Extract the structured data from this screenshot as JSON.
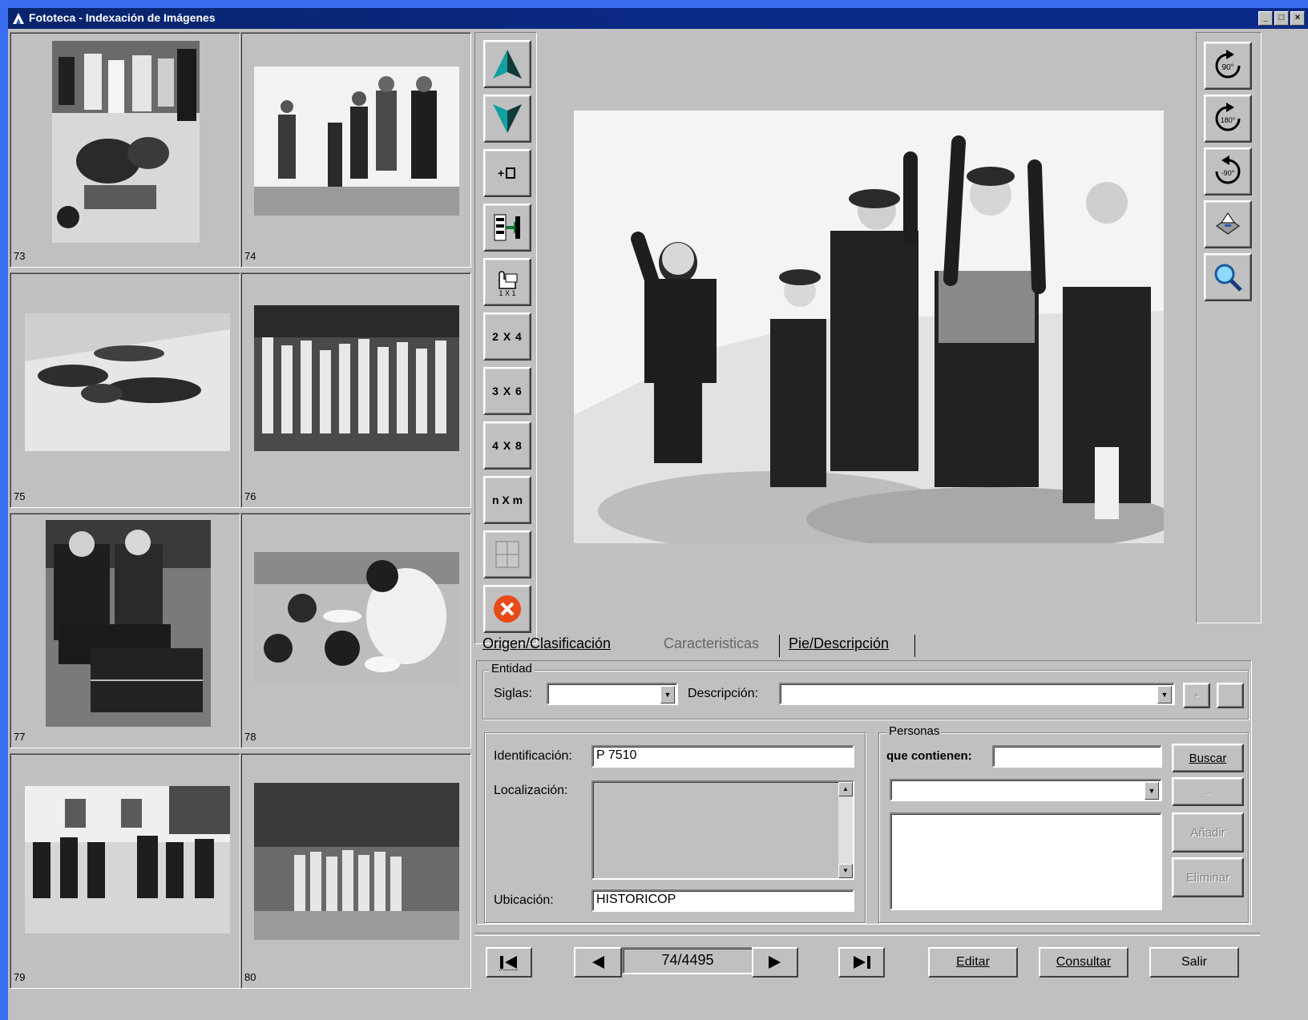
{
  "window": {
    "title": "Fototeca - Indexación de Imágenes"
  },
  "window_buttons": [
    "_",
    "□",
    "×"
  ],
  "thumbnails": [
    {
      "number": "73"
    },
    {
      "number": "74"
    },
    {
      "number": "75"
    },
    {
      "number": "76"
    },
    {
      "number": "77"
    },
    {
      "number": "78"
    },
    {
      "number": "79"
    },
    {
      "number": "80"
    }
  ],
  "toolbar": {
    "layout_2x4": "2 X 4",
    "layout_3x6": "3 X 6",
    "layout_4x8": "4 X 8",
    "layout_nxm": "n X m",
    "one_by_one": "1 X 1"
  },
  "rotate": {
    "rot_90": "90°",
    "rot_180": "180°",
    "rot_neg90": "-90°"
  },
  "tabs": [
    {
      "label": "Origen/Clasificación",
      "active": true
    },
    {
      "label": "Caracteristicas",
      "active": false
    },
    {
      "label": "Pie/Descripción",
      "active": false
    }
  ],
  "entidad": {
    "group_title": "Entidad",
    "siglas_label": "Siglas:",
    "siglas_value": "",
    "descripcion_label": "Descripción:",
    "descripcion_value": ""
  },
  "fields": {
    "identificacion_label": "Identificación:",
    "identificacion_value": "P 7510",
    "localizacion_label": "Localización:",
    "localizacion_value": "",
    "ubicacion_label": "Ubicación:",
    "ubicacion_value": "HISTORICOP"
  },
  "personas": {
    "group_title": "Personas",
    "contain_label": "que contienen:",
    "search_value": "",
    "buscar": "Buscar",
    "blank_button": "...",
    "anadir": "Añadir",
    "eliminar": "Eliminar"
  },
  "nav": {
    "record": "74/4495",
    "editar": "Editar",
    "consultar": "Consultar",
    "salir": "Salir"
  },
  "colors": {
    "titlebar": "#0a2a8a",
    "face": "#c0c0c0",
    "arrow_teal": "#0e8a8a",
    "close_red": "#e84a1a"
  }
}
